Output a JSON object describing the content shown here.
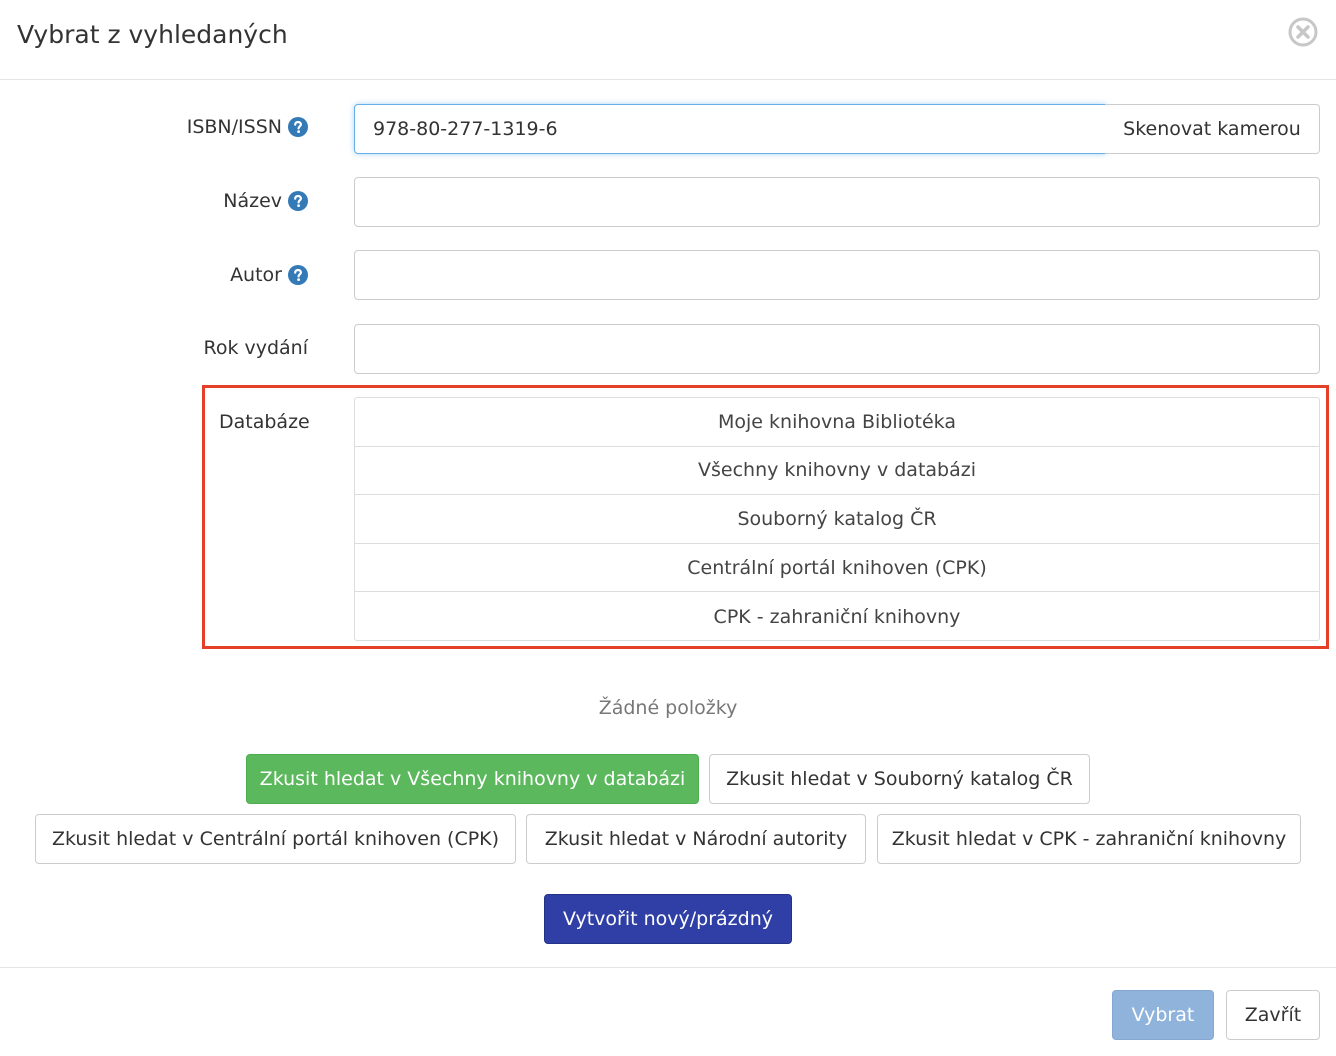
{
  "dialog": {
    "title": "Vybrat z vyhledaných"
  },
  "form": {
    "isbn": {
      "label": "ISBN/ISSN",
      "value": "978-80-277-1319-6",
      "scan_label": "Skenovat kamerou"
    },
    "title": {
      "label": "Název",
      "value": ""
    },
    "author": {
      "label": "Autor",
      "value": ""
    },
    "year": {
      "label": "Rok vydání",
      "value": ""
    },
    "databases": {
      "label": "Databáze",
      "items": [
        "Moje knihovna Bibliotéka",
        "Všechny knihovny v databázi",
        "Souborný katalog ČR",
        "Centrální portál knihoven (CPK)",
        "CPK - zahraniční knihovny"
      ]
    }
  },
  "results": {
    "empty_text": "Žádné položky"
  },
  "actions": {
    "try_all": "Zkusit hledat v Všechny knihovny v databázi",
    "try_skc": "Zkusit hledat v Souborný katalog ČR",
    "try_cpk": "Zkusit hledat v Centrální portál knihoven (CPK)",
    "try_authority": "Zkusit hledat v Národní autority",
    "try_cpk_foreign": "Zkusit hledat v CPK - zahraniční knihovny",
    "create_new": "Vytvořit nový/prázdný"
  },
  "footer": {
    "select": "Vybrat",
    "close": "Zavřít"
  },
  "colors": {
    "help_icon": "#337ab7",
    "highlight": "#e53f2a",
    "success": "#5cb85c",
    "primary_dark": "#2f3fa5",
    "primary_disabled": "#8fb3db"
  },
  "icons": {
    "help": "question-circle-icon",
    "close": "close-circle-icon"
  }
}
